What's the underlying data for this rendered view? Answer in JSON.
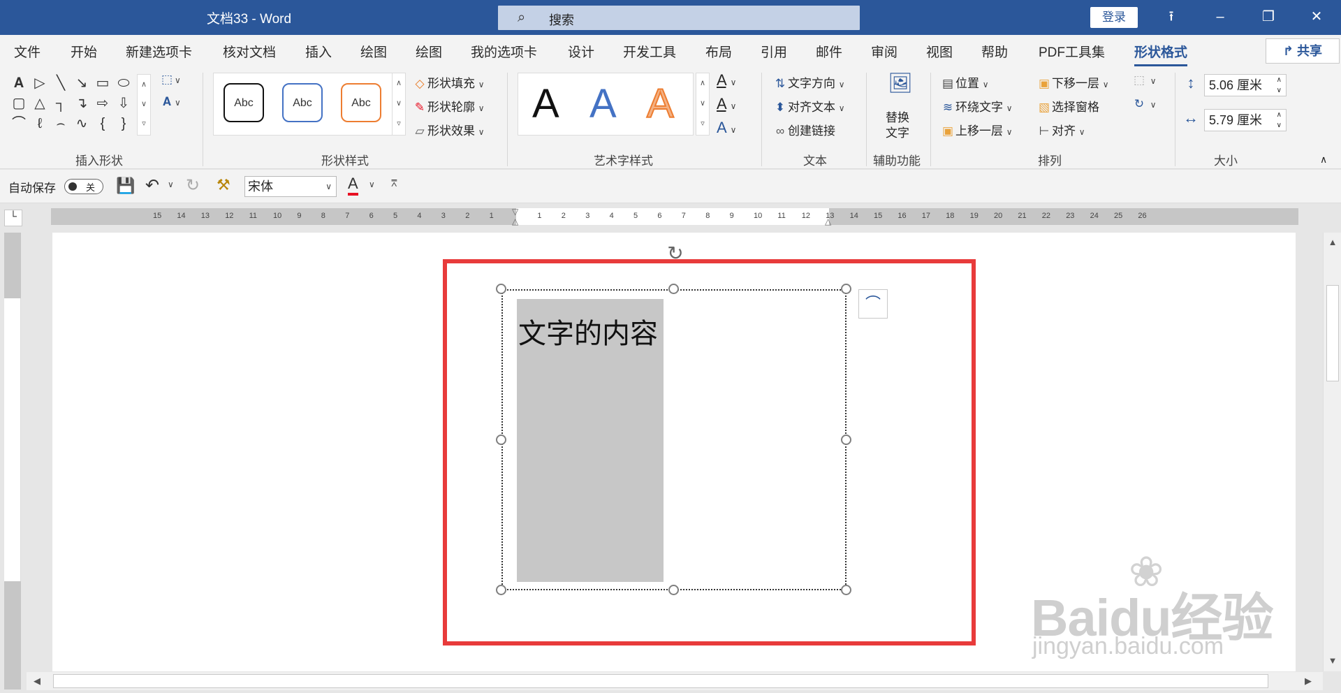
{
  "window": {
    "title": "文档33  -  Word",
    "search_placeholder": "搜索",
    "login": "登录",
    "share": "共享"
  },
  "tabs": [
    "文件",
    "开始",
    "新建选项卡",
    "核对文档",
    "插入",
    "绘图",
    "绘图",
    "我的选项卡",
    "设计",
    "开发工具",
    "布局",
    "引用",
    "邮件",
    "审阅",
    "视图",
    "帮助",
    "PDF工具集",
    "形状格式"
  ],
  "active_tab": "形状格式",
  "ribbon": {
    "groups": {
      "insert_shapes": "插入形状",
      "shape_styles": "形状样式",
      "wordart_styles": "艺术字样式",
      "text": "文本",
      "accessibility": "辅助功能",
      "arrange": "排列",
      "size": "大小"
    },
    "shape_style_sample": "Abc",
    "shape_fill": "形状填充",
    "shape_outline": "形状轮廓",
    "shape_effects": "形状效果",
    "wordart_sample": "A",
    "text_direction": "文字方向",
    "align_text": "对齐文本",
    "create_link": "创建链接",
    "alt_text_line1": "替换",
    "alt_text_line2": "文字",
    "position": "位置",
    "wrap_text": "环绕文字",
    "bring_forward": "上移一层",
    "send_backward": "下移一层",
    "selection_pane": "选择窗格",
    "align": "对齐",
    "height": "5.06 厘米",
    "width": "5.79 厘米"
  },
  "qat": {
    "autosave": "自动保存",
    "autosave_state": "关",
    "font": "宋体"
  },
  "document": {
    "shape_text": "文字的内容"
  },
  "ruler": {
    "h_left": [
      "15",
      "14",
      "13",
      "12",
      "11",
      "10",
      "9",
      "8",
      "7",
      "6",
      "5",
      "4",
      "3",
      "2",
      "1"
    ],
    "h_right": [
      "1",
      "2",
      "3",
      "4",
      "5",
      "6",
      "7",
      "8",
      "9",
      "10",
      "11",
      "12",
      "13",
      "14",
      "15",
      "16",
      "17",
      "18",
      "19",
      "20",
      "21",
      "22",
      "23",
      "24",
      "25",
      "26"
    ]
  },
  "watermark": {
    "brand": "Baidu经验",
    "url": "jingyan.baidu.com"
  },
  "colors": {
    "accent": "#2b579a",
    "highlight_border": "#e83b3b",
    "shape_fill": "#c7c7c7"
  }
}
